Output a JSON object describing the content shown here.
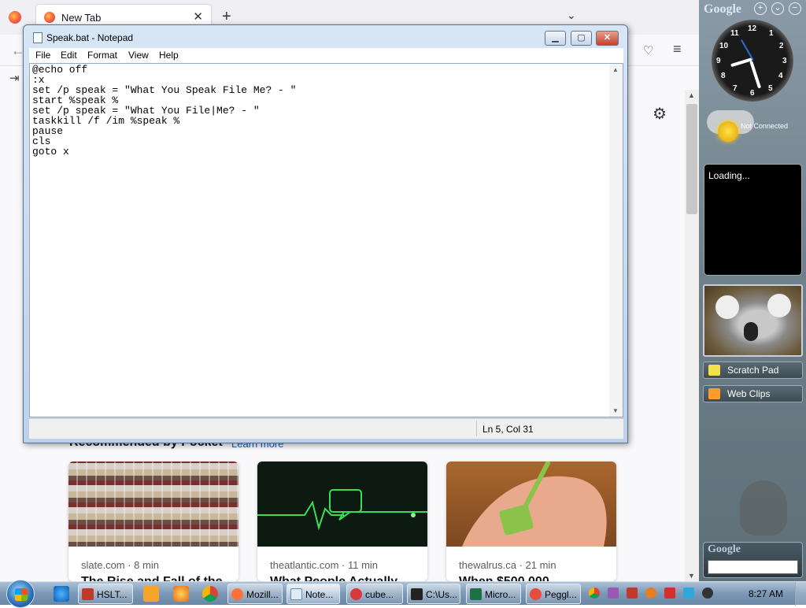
{
  "firefox": {
    "tab_label": "New Tab",
    "tab_close": "✕",
    "new_tab_icon": "+",
    "list_tabs_icon": "⌄",
    "back_icon": "←",
    "signin_icon": "⇥",
    "pocket_icon": "♡",
    "menu_icon": "≡",
    "settings_icon": "⚙",
    "pocket_heading": "Recommended by Pocket",
    "pocket_learn_more": "Learn more",
    "cards": [
      {
        "source": "slate.com · 8 min",
        "title": "The Rise and Fall of the"
      },
      {
        "source": "theatlantic.com · 11 min",
        "title": "What People Actually"
      },
      {
        "source": "thewalrus.ca · 21 min",
        "title": "When $500,000"
      }
    ]
  },
  "notepad": {
    "title": "Speak.bat - Notepad",
    "min_icon": "▁",
    "max_icon": "▢",
    "close_icon": "✕",
    "menus": [
      "File",
      "Edit",
      "Format",
      "View",
      "Help"
    ],
    "content": "@echo off\n:x\nset /p speak = \"What You Speak File Me? - \"\nstart %speak %\nset /p speak = \"What You File|Me? - \"\ntaskkill /f /im %speak %\npause\ncls\ngoto x",
    "status": "Ln 5, Col 31"
  },
  "sidebar": {
    "brand": "Google",
    "add_icon": "+",
    "options_icon": "⌄",
    "collapse_icon": "−",
    "clock_numbers": [
      "12",
      "1",
      "2",
      "3",
      "4",
      "5",
      "6",
      "7",
      "8",
      "9",
      "10",
      "11"
    ],
    "weather_status": "Not Connected",
    "feed_status": "Loading...",
    "scratch_pad": "Scratch Pad",
    "web_clips": "Web Clips",
    "search_brand": "Google"
  },
  "taskbar": {
    "buttons": [
      {
        "label": "HSLT...",
        "color": "#c0392b"
      },
      {
        "label": "Mozill...",
        "color": "#ff7139"
      },
      {
        "label": "Note...",
        "color": "#dfeaf5"
      },
      {
        "label": "cube...",
        "color": "#d63a3a"
      },
      {
        "label": "C:\\Us...",
        "color": "#222222"
      },
      {
        "label": "Micro...",
        "color": "#1e7145"
      },
      {
        "label": "Peggl...",
        "color": "#e74c3c"
      }
    ],
    "time": "8:27 AM"
  }
}
